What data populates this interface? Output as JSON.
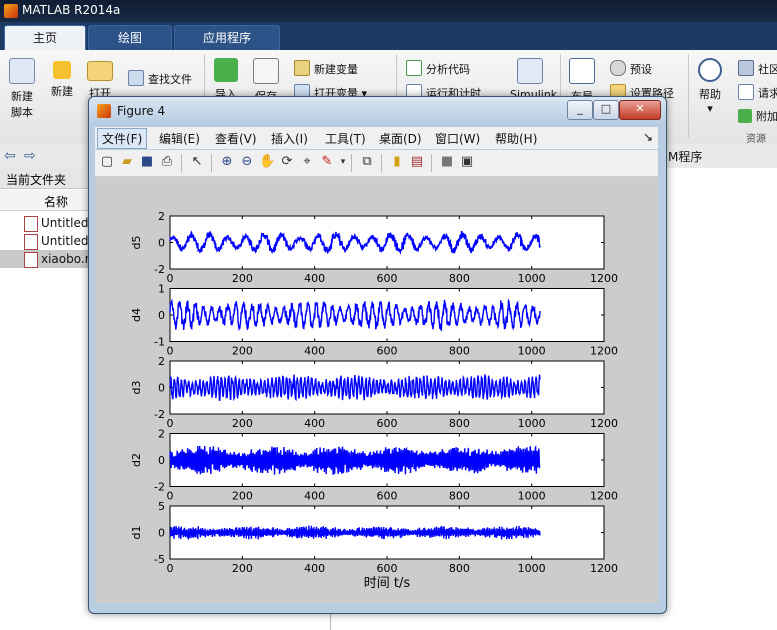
{
  "app": {
    "title": "MATLAB R2014a",
    "tabs": [
      "主页",
      "绘图",
      "应用程序"
    ],
    "ribbon": {
      "new_script": "新建\n脚本",
      "new": "新建",
      "open": "打开",
      "find_files": "查找文件",
      "import": "导入",
      "save": "保存",
      "new_variable": "新建变量",
      "open_variable": "打开变量",
      "analyze_code": "分析代码",
      "run_and_time": "运行和计时",
      "simulink": "Simulink",
      "layout": "布局",
      "preferences": "预设",
      "set_path": "设置路径",
      "help": "帮助",
      "community": "社区",
      "request_support": "请求",
      "add_ons": "附加",
      "resources": "资源"
    },
    "path_suffix": "M程序",
    "current_folder": "当前文件夹",
    "name_col": "名称",
    "files": [
      "Untitled.",
      "Untitled",
      "xiaobo.m"
    ]
  },
  "figure": {
    "title": "Figure 4",
    "window_buttons": [
      "_",
      "□",
      "✕"
    ],
    "menu": [
      "文件(F)",
      "编辑(E)",
      "查看(V)",
      "插入(I)",
      "工具(T)",
      "桌面(D)",
      "窗口(W)",
      "帮助(H)"
    ],
    "menu_arrow": "↘",
    "toolbar_icons": [
      "new-figure-icon",
      "open-icon",
      "save-icon",
      "print-icon",
      "pointer-icon",
      "zoom-in-icon",
      "zoom-out-icon",
      "pan-icon",
      "rotate-icon",
      "data-cursor-icon",
      "brush-icon",
      "link-icon",
      "colorbar-icon",
      "legend-icon",
      "hide-plot-tools-icon",
      "show-plot-tools-icon"
    ]
  },
  "chart_data": [
    {
      "type": "line",
      "ylabel": "d5",
      "xlim": [
        0,
        1200
      ],
      "ylim": [
        -2,
        2
      ],
      "yticks": [
        -2,
        0,
        2
      ],
      "xticks": [
        0,
        200,
        400,
        600,
        800,
        1000,
        1200
      ],
      "series": [
        {
          "color": "#0000ff",
          "n": 1024,
          "amplitude": 0.8
        }
      ]
    },
    {
      "type": "line",
      "ylabel": "d4",
      "xlim": [
        0,
        1200
      ],
      "ylim": [
        -1,
        1
      ],
      "yticks": [
        -1,
        0,
        1
      ],
      "xticks": [
        0,
        200,
        400,
        600,
        800,
        1000,
        1200
      ],
      "series": [
        {
          "color": "#0000ff",
          "n": 1024,
          "amplitude": 0.55
        }
      ]
    },
    {
      "type": "line",
      "ylabel": "d3",
      "xlim": [
        0,
        1200
      ],
      "ylim": [
        -2,
        2
      ],
      "yticks": [
        -2,
        0,
        2
      ],
      "xticks": [
        0,
        200,
        400,
        600,
        800,
        1000,
        1200
      ],
      "series": [
        {
          "color": "#0000ff",
          "n": 1024,
          "amplitude": 1.0
        }
      ]
    },
    {
      "type": "line",
      "ylabel": "d2",
      "xlim": [
        0,
        1200
      ],
      "ylim": [
        -2,
        2
      ],
      "yticks": [
        -2,
        0,
        2
      ],
      "xticks": [
        0,
        200,
        400,
        600,
        800,
        1000,
        1200
      ],
      "series": [
        {
          "color": "#0000ff",
          "n": 1024,
          "amplitude": 1.1
        }
      ]
    },
    {
      "type": "line",
      "ylabel": "d1",
      "xlim": [
        0,
        1200
      ],
      "ylim": [
        -5,
        5
      ],
      "yticks": [
        -5,
        0,
        5
      ],
      "xticks": [
        0,
        200,
        400,
        600,
        800,
        1000,
        1200
      ],
      "xlabel": "时间 t/s",
      "series": [
        {
          "color": "#0000ff",
          "n": 1024,
          "amplitude": 1.3
        }
      ]
    }
  ]
}
